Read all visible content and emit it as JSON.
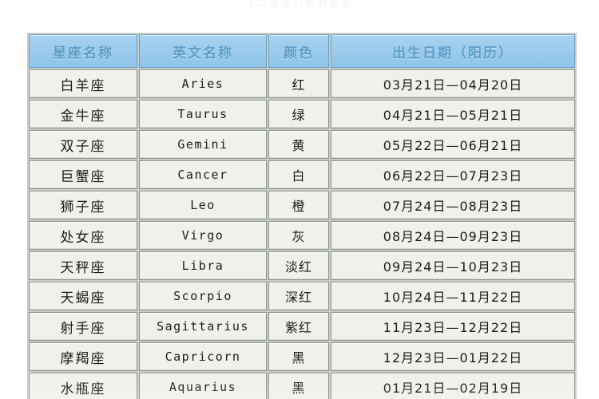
{
  "document": {
    "clipped_title": "十二星座日期对照表",
    "background_color": "#ffffff"
  },
  "table": {
    "header_background": "#9fcdee",
    "header_text_color": "#5d9ec9",
    "cell_background": "#f1f1ec",
    "border_color": "#8c928f",
    "columns": [
      {
        "key": "name",
        "label": "星座名称"
      },
      {
        "key": "en",
        "label": "英文名称"
      },
      {
        "key": "color",
        "label": "颜色"
      },
      {
        "key": "date",
        "label": "出生日期（阳历）"
      }
    ],
    "rows": [
      {
        "name": "白羊座",
        "en": "Aries",
        "color": "红",
        "date": "03月21日—04月20日"
      },
      {
        "name": "金牛座",
        "en": "Taurus",
        "color": "绿",
        "date": "04月21日—05月21日"
      },
      {
        "name": "双子座",
        "en": "Gemini",
        "color": "黄",
        "date": "05月22日—06月21日"
      },
      {
        "name": "巨蟹座",
        "en": "Cancer",
        "color": "白",
        "date": "06月22日—07月23日"
      },
      {
        "name": "狮子座",
        "en": "Leo",
        "color": "橙",
        "date": "07月24日—08月23日"
      },
      {
        "name": "处女座",
        "en": "Virgo",
        "color": "灰",
        "date": "08月24日—09月23日"
      },
      {
        "name": "天秤座",
        "en": "Libra",
        "color": "淡红",
        "date": "09月24日—10月23日"
      },
      {
        "name": "天蝎座",
        "en": "Scorpio",
        "color": "深红",
        "date": "10月24日—11月22日"
      },
      {
        "name": "射手座",
        "en": "Sagittarius",
        "color": "紫红",
        "date": "11月23日—12月22日"
      },
      {
        "name": "摩羯座",
        "en": "Capricorn",
        "color": "黑",
        "date": "12月23日—01月22日"
      },
      {
        "name": "水瓶座",
        "en": "Aquarius",
        "color": "黑",
        "date": "01月21日—02月19日"
      }
    ]
  }
}
